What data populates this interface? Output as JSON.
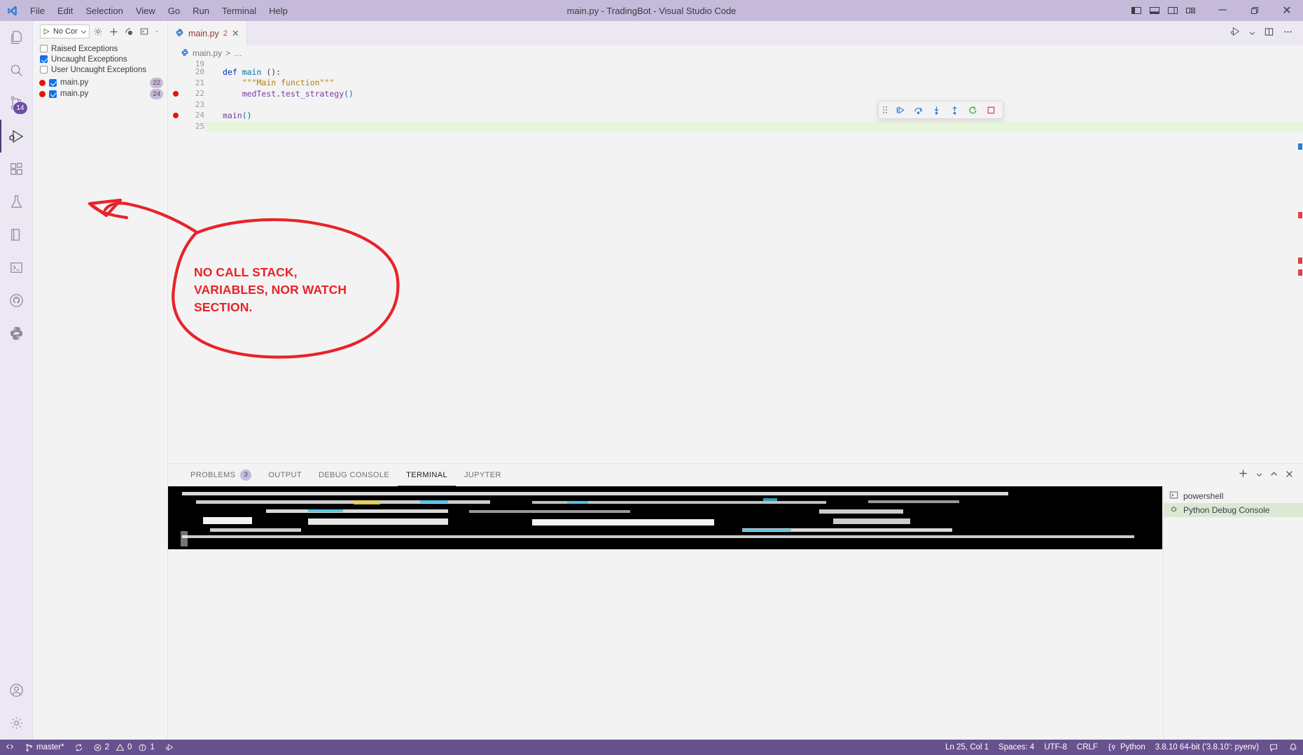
{
  "window": {
    "title": "main.py - TradingBot - Visual Studio Code",
    "menus": [
      "File",
      "Edit",
      "Selection",
      "View",
      "Go",
      "Run",
      "Terminal",
      "Help"
    ],
    "layout_icons": [
      "toggle-primary-sidebar-icon",
      "toggle-panel-icon",
      "toggle-secondary-sidebar-icon",
      "customize-layout-icon"
    ],
    "controls": {
      "minimize": "─",
      "maximize": "❐",
      "close": "✕"
    }
  },
  "activity_bar": {
    "items": [
      {
        "name": "explorer",
        "icon": "files-icon",
        "badge": ""
      },
      {
        "name": "search",
        "icon": "search-icon",
        "badge": ""
      },
      {
        "name": "source-control",
        "icon": "source-control-icon",
        "badge": "14"
      },
      {
        "name": "run-and-debug",
        "icon": "run-debug-icon",
        "badge": "",
        "active": true
      },
      {
        "name": "extensions",
        "icon": "extensions-icon",
        "badge": ""
      },
      {
        "name": "testing",
        "icon": "beaker-icon",
        "badge": ""
      },
      {
        "name": "notebook",
        "icon": "notebook-icon",
        "badge": ""
      },
      {
        "name": "terminal-view",
        "icon": "terminal-icon",
        "badge": ""
      },
      {
        "name": "github",
        "icon": "github-icon",
        "badge": ""
      },
      {
        "name": "python",
        "icon": "python-icon",
        "badge": ""
      }
    ],
    "bottom_items": [
      {
        "name": "accounts",
        "icon": "account-icon"
      },
      {
        "name": "settings",
        "icon": "gear-icon"
      }
    ]
  },
  "sidebar": {
    "launch_config": "No Cor",
    "toolbar_icons": [
      "start-debugging-icon",
      "config-gear-icon",
      "add-config-icon",
      "breakpoint-icon",
      "open-debug-console-icon",
      "more-icon"
    ],
    "exceptions": [
      {
        "label": "Raised Exceptions",
        "checked": false
      },
      {
        "label": "Uncaught Exceptions",
        "checked": true
      },
      {
        "label": "User Uncaught Exceptions",
        "checked": false
      }
    ],
    "breakpoints": [
      {
        "file": "main.py",
        "line": "22",
        "checked": true,
        "enabled": true
      },
      {
        "file": "main.py",
        "line": "24",
        "checked": true,
        "enabled": true
      }
    ]
  },
  "editor": {
    "tab": {
      "label": "main.py",
      "badge": "2",
      "close": "✕",
      "icon": "python-file-icon"
    },
    "tab_actions": [
      "run-python-file-icon",
      "chevron-down-icon",
      "split-editor-icon",
      "more-actions-icon"
    ],
    "breadcrumb": [
      "main.py",
      "…"
    ],
    "first_visible_line": 19,
    "lines": [
      {
        "num": "19",
        "text": "",
        "bp": false,
        "current": false
      },
      {
        "num": "20",
        "text": "def main ():",
        "bp": false,
        "current": false
      },
      {
        "num": "21",
        "text": "    \"\"\"Main function\"\"\"",
        "bp": false,
        "current": false
      },
      {
        "num": "22",
        "text": "    medTest.test_strategy()",
        "bp": true,
        "current": false
      },
      {
        "num": "23",
        "text": "",
        "bp": false,
        "current": false
      },
      {
        "num": "24",
        "text": "main()",
        "bp": true,
        "current": false
      },
      {
        "num": "25",
        "text": "",
        "bp": false,
        "current": true
      }
    ],
    "debug_toolbar": {
      "buttons": [
        "drag-handle",
        "continue-icon",
        "step-over-icon",
        "step-into-icon",
        "step-out-icon",
        "restart-icon",
        "stop-icon"
      ]
    }
  },
  "panel": {
    "tabs": [
      {
        "label": "PROBLEMS",
        "badge": "3",
        "active": false
      },
      {
        "label": "OUTPUT",
        "badge": "",
        "active": false
      },
      {
        "label": "DEBUG CONSOLE",
        "badge": "",
        "active": false
      },
      {
        "label": "TERMINAL",
        "badge": "",
        "active": true
      },
      {
        "label": "JUPYTER",
        "badge": "",
        "active": false
      }
    ],
    "actions": [
      "new-terminal-icon",
      "chevron-down-icon",
      "maximize-panel-icon",
      "close-panel-icon"
    ],
    "terminals": [
      {
        "label": "powershell",
        "icon": "terminal-icon",
        "active": false
      },
      {
        "label": "Python Debug Console",
        "icon": "debug-console-icon",
        "active": true
      }
    ]
  },
  "status_bar": {
    "left": [
      {
        "name": "remote-indicator",
        "icon": "remote-icon",
        "label": ""
      },
      {
        "name": "branch",
        "icon": "branch-icon",
        "label": "master*"
      },
      {
        "name": "sync-changes",
        "icon": "sync-icon",
        "label": ""
      },
      {
        "name": "errors",
        "icon": "error-icon",
        "label": "2"
      },
      {
        "name": "warnings",
        "icon": "warning-icon",
        "label": "0"
      },
      {
        "name": "infos",
        "icon": "info-icon",
        "label": "1"
      },
      {
        "name": "debug-status",
        "icon": "run-debug-icon",
        "label": ""
      }
    ],
    "right": [
      {
        "name": "cursor-position",
        "label": "Ln 25, Col 1"
      },
      {
        "name": "indentation",
        "label": "Spaces: 4"
      },
      {
        "name": "encoding",
        "label": "UTF-8"
      },
      {
        "name": "eol",
        "label": "CRLF"
      },
      {
        "name": "language-mode",
        "icon": "python-icon",
        "label": "Python"
      },
      {
        "name": "python-interpreter",
        "label": "3.8.10 64-bit ('3.8.10': pyenv)"
      },
      {
        "name": "feedback",
        "icon": "feedback-icon",
        "label": ""
      },
      {
        "name": "notifications",
        "icon": "bell-icon",
        "label": ""
      }
    ]
  },
  "annotation": {
    "text_lines": [
      "NO CALL STACK,",
      "VARIABLES, NOR WATCH",
      "SECTION."
    ],
    "color": "#e8232a",
    "shape": "hand-drawn-ellipse-with-arrow"
  },
  "colors": {
    "titlebar": "#c6bada",
    "activitybar": "#ece8f3",
    "editor_bg": "#f3f3f3",
    "statusbar": "#68518f",
    "accent": "#6c4fa1",
    "breakpoint_red": "#e51400",
    "annotation_red": "#e8232a",
    "current_line": "#e7f5dc"
  }
}
